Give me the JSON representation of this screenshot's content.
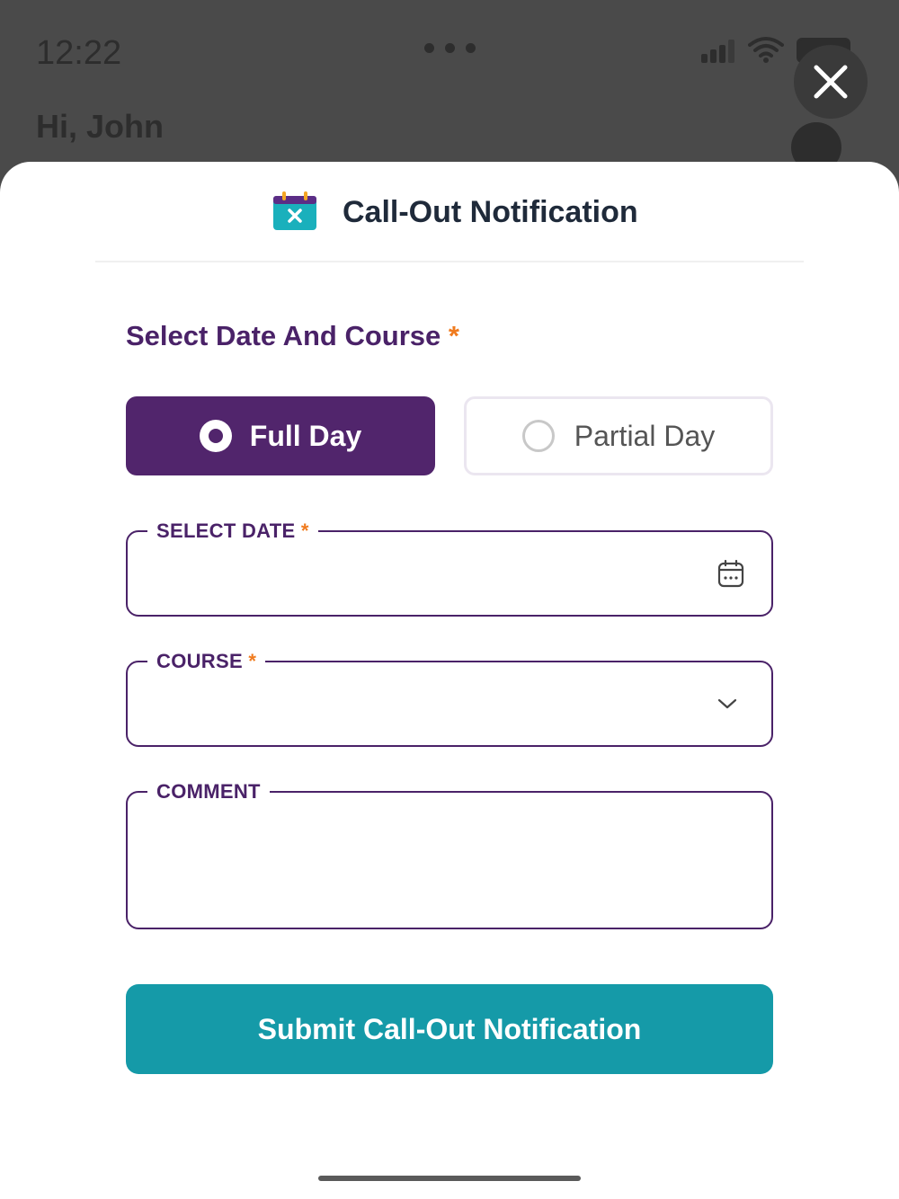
{
  "status_bar": {
    "time": "12:22"
  },
  "background": {
    "greeting": "Hi, John"
  },
  "modal": {
    "title": "Call-Out Notification",
    "header_icon": "calendar-x-icon",
    "close_icon": "close-icon"
  },
  "form": {
    "section_label": "Select Date And Course",
    "required_mark": "*",
    "day_type": {
      "options": [
        "Full Day",
        "Partial Day"
      ],
      "selected": "Full Day"
    },
    "date_field": {
      "label": "SELECT DATE",
      "value": "",
      "icon": "calendar-icon"
    },
    "course_field": {
      "label": "COURSE",
      "value": "",
      "icon": "chevron-down-icon"
    },
    "comment_field": {
      "label": "COMMENT",
      "value": ""
    },
    "submit_label": "Submit Call-Out Notification"
  },
  "colors": {
    "primary_purple": "#51256c",
    "accent_orange": "#f07b1e",
    "submit_teal": "#159aa8",
    "title_dark": "#1f2a3a"
  }
}
